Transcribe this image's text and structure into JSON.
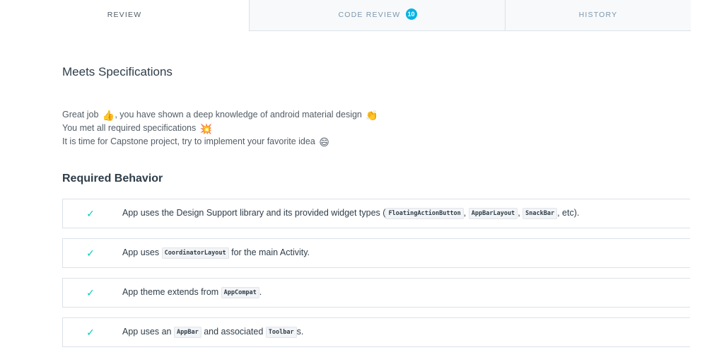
{
  "tabs": {
    "review": "REVIEW",
    "code_review": "CODE REVIEW",
    "code_review_count": "10",
    "history": "HISTORY"
  },
  "heading": "Meets Specifications",
  "summary": {
    "line1_a": "Great job",
    "line1_b": ", you have shown a deep knowledge of android material design",
    "line2": "You met all required specifications",
    "line3": "It is time for Capstone project, try to implement your favorite idea"
  },
  "icons": {
    "thumbs_up": "👍",
    "clapping": "👏",
    "collision": "💥",
    "smile": "😄",
    "check": "✓"
  },
  "colors": {
    "accent": "#02b3e4",
    "check": "#02ccba"
  },
  "section": {
    "title": "Required Behavior"
  },
  "criteria": {
    "c1": {
      "t1": "App uses the Design Support library and its provided widget types (",
      "code1": "FloatingActionButton",
      "sep1": ",",
      "code2": "AppBarLayout",
      "sep2": ",",
      "code3": "SnackBar",
      "t2": ", etc)."
    },
    "c2": {
      "t1": "App uses",
      "code1": "CoordinatorLayout",
      "t2": "for the main Activity."
    },
    "c3": {
      "t1": "App theme extends from",
      "code1": "AppCompat",
      "t2": "."
    },
    "c4": {
      "t1": "App uses an",
      "code1": "AppBar",
      "t2": "and associated",
      "code2": "Toolbar",
      "t3": "s."
    }
  }
}
